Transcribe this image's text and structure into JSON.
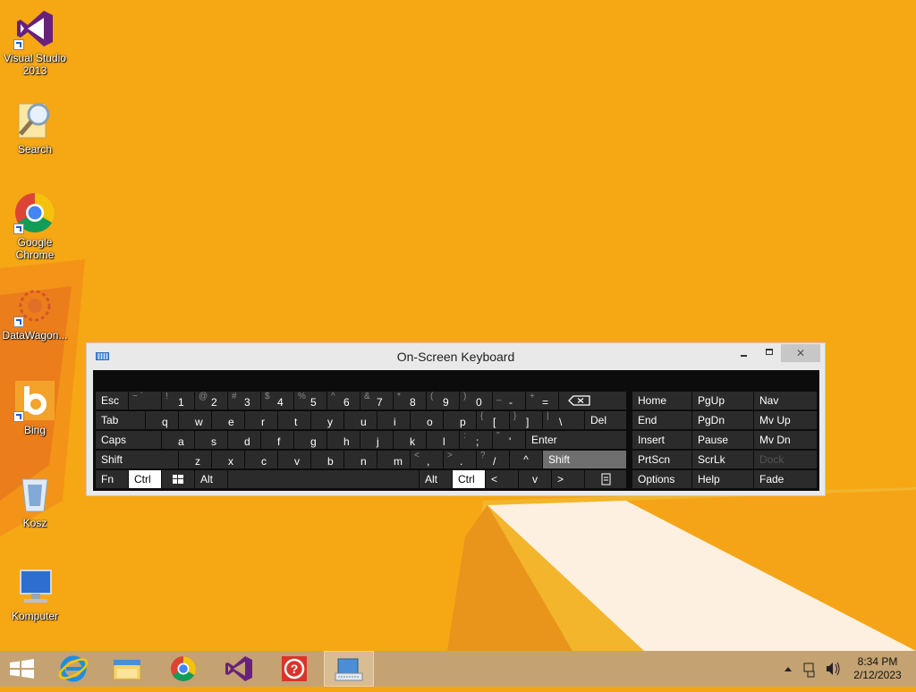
{
  "desktop": {
    "icons": [
      {
        "name": "visual-studio",
        "label": "Visual Studio 2013"
      },
      {
        "name": "search",
        "label": "Search"
      },
      {
        "name": "google-chrome",
        "label": "Google Chrome"
      },
      {
        "name": "datawagon",
        "label": "DataWagon..."
      },
      {
        "name": "bing",
        "label": "Bing"
      },
      {
        "name": "kosz",
        "label": "Kosz"
      },
      {
        "name": "komputer",
        "label": "Komputer"
      }
    ]
  },
  "osk": {
    "title": "On-Screen Keyboard",
    "keys": {
      "esc": "Esc",
      "tilde_sub": "~ `",
      "k1_sub": "!",
      "k1": "1",
      "k2_sub": "@",
      "k2": "2",
      "k3_sub": "#",
      "k3": "3",
      "k4_sub": "$",
      "k4": "4",
      "k5_sub": "%",
      "k5": "5",
      "k6_sub": "^",
      "k6": "6",
      "k7_sub": "&",
      "k7": "7",
      "k8_sub": "*",
      "k8": "8",
      "k9_sub": "(",
      "k9": "9",
      "k0_sub": ")",
      "k0": "0",
      "minus_sub": "_",
      "minus": "-",
      "equals_sub": "+",
      "equals": "=",
      "tab": "Tab",
      "q": "q",
      "w": "w",
      "e": "e",
      "r": "r",
      "t": "t",
      "y": "y",
      "u": "u",
      "i": "i",
      "o": "o",
      "p": "p",
      "lbracket_sub": "{",
      "lbracket": "[",
      "rbracket_sub": "}",
      "rbracket": "]",
      "backslash_sub": "|",
      "backslash": "\\",
      "del": "Del",
      "caps": "Caps",
      "a": "a",
      "s": "s",
      "d": "d",
      "f": "f",
      "g": "g",
      "h": "h",
      "j": "j",
      "k": "k",
      "l": "l",
      "semicolon_sub": ":",
      "semicolon": ";",
      "quote_sub": "\"",
      "quote": "'",
      "enter": "Enter",
      "shift_l": "Shift",
      "z": "z",
      "x": "x",
      "c": "c",
      "v": "v",
      "b": "b",
      "n": "n",
      "m": "m",
      "comma_sub": "<",
      "comma": ",",
      "period_sub": ">",
      "period": ".",
      "slash_sub": "?",
      "slash": "/",
      "up": "^",
      "shift_r": "Shift",
      "fn": "Fn",
      "ctrl_l": "Ctrl",
      "alt_l": "Alt",
      "alt_r": "Alt",
      "ctrl_r": "Ctrl",
      "left": "<",
      "down": "v",
      "right": ">",
      "home": "Home",
      "pgup": "PgUp",
      "nav": "Nav",
      "end": "End",
      "pgdn": "PgDn",
      "mvup": "Mv Up",
      "insert": "Insert",
      "pause": "Pause",
      "mvdn": "Mv Dn",
      "prtscn": "PrtScn",
      "scrlk": "ScrLk",
      "dock": "Dock",
      "options": "Options",
      "help": "Help",
      "fade": "Fade"
    }
  },
  "taskbar": {
    "items": [
      "start",
      "internet-explorer",
      "file-explorer",
      "google-chrome",
      "visual-studio",
      "help",
      "on-screen-keyboard"
    ],
    "clock_time": "8:34 PM",
    "clock_date": "2/12/2023"
  },
  "colors": {
    "desktop": "#f5a511",
    "taskbar": "#c4a272",
    "key": "#2b2b2b",
    "key_active": "#ffffff",
    "key_highlight": "#6f6f6f"
  }
}
